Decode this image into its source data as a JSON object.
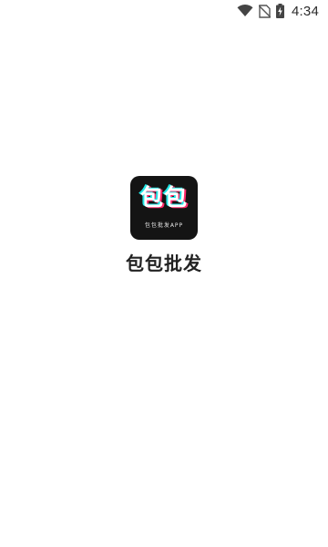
{
  "status_bar": {
    "time": "4:34",
    "icons": [
      "wifi-icon",
      "no-sim-icon",
      "battery-charging-icon"
    ]
  },
  "splash": {
    "icon_glyphs": "包包",
    "icon_caption": "包包批发APP",
    "app_name": "包包批发"
  },
  "colors": {
    "background": "#ffffff",
    "icon_background": "#141414",
    "glitch_cyan": "#22e6e6",
    "glitch_pink": "#ff2a6b",
    "title_text": "#222222"
  }
}
